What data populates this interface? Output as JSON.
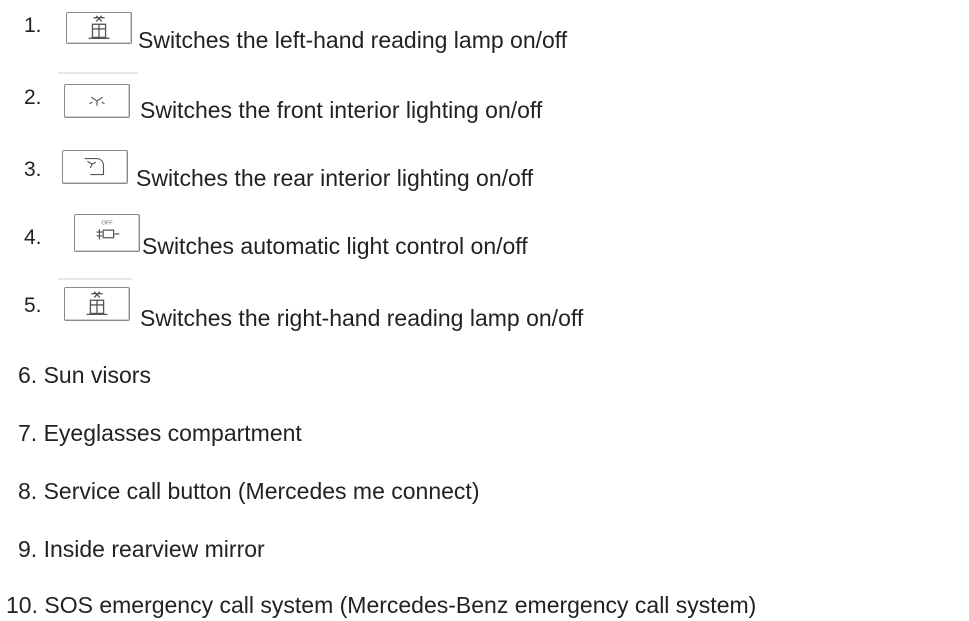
{
  "items_with_icons": [
    {
      "number": "1.",
      "icon": "reading-lamp-left-icon",
      "text": "Switches the left-hand reading lamp on/off"
    },
    {
      "number": "2.",
      "icon": "front-interior-lighting-icon",
      "text": "Switches the front interior lighting on/off"
    },
    {
      "number": "3.",
      "icon": "rear-interior-lighting-icon",
      "text": "Switches the rear interior lighting on/off"
    },
    {
      "number": "4.",
      "icon": "automatic-light-control-icon",
      "text": "Switches automatic light control on/off"
    },
    {
      "number": "5.",
      "icon": "reading-lamp-right-icon",
      "text": "Switches the right-hand reading lamp on/off"
    }
  ],
  "items_plain": [
    "6. Sun visors",
    "7. Eyeglasses compartment",
    "8. Service call button (Mercedes me connect)",
    "9. Inside rearview mirror",
    "10. SOS emergency call system (Mercedes-Benz emergency call system)"
  ],
  "icon_labels": {
    "off_label": "OFF"
  },
  "colors": {
    "text": "#222222",
    "icon_border": "#8a8a8a",
    "icon_glyph": "#555555"
  }
}
